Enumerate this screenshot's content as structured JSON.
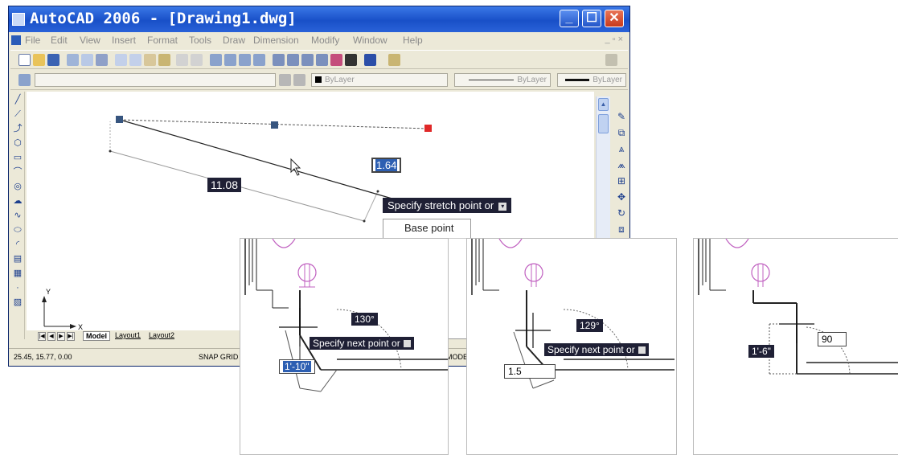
{
  "window": {
    "title": "AutoCAD 2006 - [Drawing1.dwg]",
    "minimize_glyph": "_",
    "maximize_glyph": "☐",
    "close_glyph": "✕"
  },
  "menu": {
    "items": [
      "File",
      "Edit",
      "View",
      "Insert",
      "Format",
      "Tools",
      "Draw",
      "Dimension",
      "Modify",
      "Window",
      "Help"
    ],
    "mdi_controls": "_ ▫ ×"
  },
  "properties_toolbar": {
    "color": "ByLayer",
    "linetype": "ByLayer",
    "lineweight": "ByLayer"
  },
  "layout_tabs": [
    "Model",
    "Layout1",
    "Layout2"
  ],
  "ucs": {
    "y_label": "Y",
    "x_label": "X"
  },
  "status": {
    "coordinates": "25.45, 15.77, 0.00",
    "toggles": "SNAP  GRID",
    "model": "MODEL"
  },
  "main_drawing": {
    "length_value": "11.08",
    "angle_input": "1.64",
    "prompt": "Specify stretch point or",
    "option": "Base point"
  },
  "panels": [
    {
      "angle": "130°",
      "prompt": "Specify next point or",
      "input": "1'-10\""
    },
    {
      "angle": "129°",
      "prompt": "Specify next point or",
      "input": "1.5"
    },
    {
      "length": "1'-6\"",
      "input": "90"
    }
  ],
  "colors": {
    "title_bar": "#2a62d8",
    "tooltip_bg": "#1f2035",
    "plan_lines": "#c060c0",
    "grip_blue": "#37557f",
    "grip_red": "#e02828"
  }
}
